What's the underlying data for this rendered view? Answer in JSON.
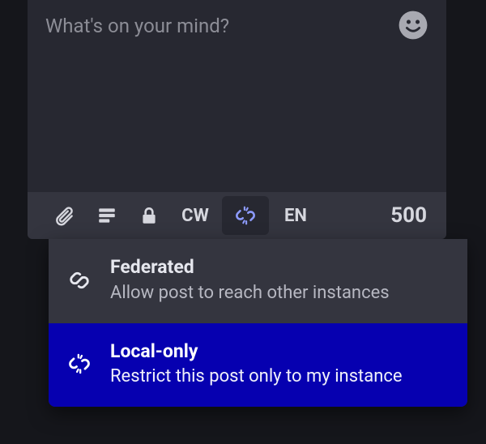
{
  "compose": {
    "placeholder": "What's on your mind?",
    "value": ""
  },
  "toolbar": {
    "cw_label": "CW",
    "lang_label": "EN",
    "char_counter": "500"
  },
  "federation_menu": {
    "options": [
      {
        "title": "Federated",
        "description": "Allow post to reach other instances",
        "selected": false
      },
      {
        "title": "Local-only",
        "description": "Restrict this post only to my instance",
        "selected": true
      }
    ]
  }
}
